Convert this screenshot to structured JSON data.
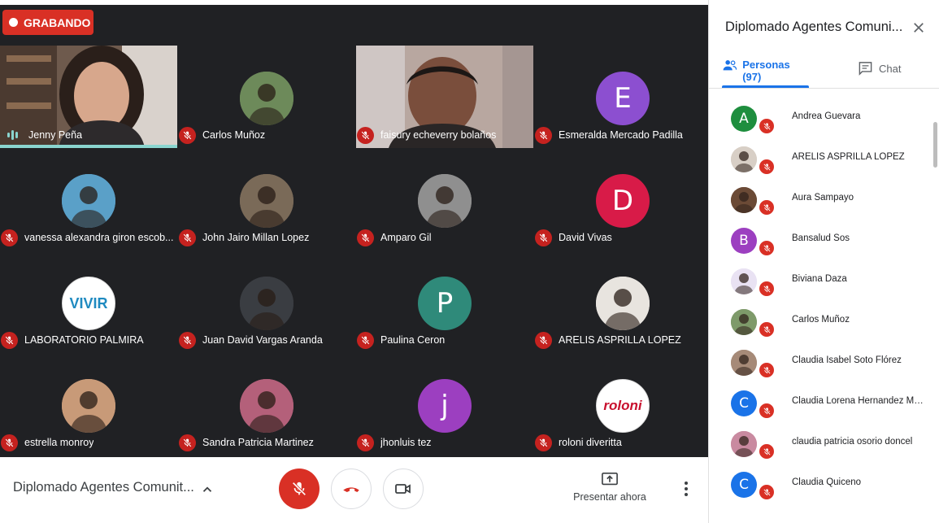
{
  "recording": {
    "label": "GRABANDO"
  },
  "participants_grid": [
    {
      "name": "Jenny Peña",
      "kind": "video",
      "speaking": true
    },
    {
      "name": "Carlos Muñoz",
      "kind": "photo",
      "color": "#6d8a5a"
    },
    {
      "name": "faisury echeverry bolaños",
      "kind": "video"
    },
    {
      "name": "Esmeralda Mercado Padilla",
      "kind": "letter",
      "letter": "E",
      "color": "#8c4fd0"
    },
    {
      "name": "vanessa alexandra giron escob...",
      "kind": "photo",
      "color": "#5aa0c8"
    },
    {
      "name": "John Jairo Millan Lopez",
      "kind": "photo",
      "color": "#7a6a58"
    },
    {
      "name": "Amparo Gil",
      "kind": "photo",
      "color": "#8f8f8f"
    },
    {
      "name": "David Vivas",
      "kind": "letter",
      "letter": "D",
      "color": "#d81b48"
    },
    {
      "name": "LABORATORIO PALMIRA",
      "kind": "logo",
      "logo_text": "VIVIR",
      "color": "#ffffff"
    },
    {
      "name": "Juan David Vargas Aranda",
      "kind": "photo",
      "color": "#3a3d42"
    },
    {
      "name": "Paulina Ceron",
      "kind": "letter",
      "letter": "P",
      "color": "#2f8a7a"
    },
    {
      "name": "ARELIS ASPRILLA LOPEZ",
      "kind": "photo",
      "color": "#e8e4df"
    },
    {
      "name": "estrella monroy",
      "kind": "photo",
      "color": "#c89a78"
    },
    {
      "name": "Sandra Patricia Martinez",
      "kind": "photo",
      "color": "#b4607a"
    },
    {
      "name": "jhonluis tez",
      "kind": "letter",
      "letter": "j",
      "color": "#9c3fc0"
    },
    {
      "name": "roloni diveritta",
      "kind": "logo",
      "logo_text": "roloni",
      "color": "#ffffff"
    }
  ],
  "bottom_bar": {
    "meeting_title": "Diplomado Agentes Comunit...",
    "present_label": "Presentar ahora"
  },
  "panel": {
    "title": "Diplomado Agentes Comuni...",
    "tab_people": "Personas (97)",
    "tab_chat": "Chat",
    "people": [
      {
        "name": "Andrea Guevara",
        "letter": "A",
        "color": "#1e8e3e"
      },
      {
        "name": "ARELIS ASPRILLA LOPEZ",
        "letter": "",
        "color": "#d8cfc6"
      },
      {
        "name": "Aura Sampayo",
        "letter": "",
        "color": "#6b4a36"
      },
      {
        "name": "Bansalud Sos",
        "letter": "B",
        "color": "#9c3fc0"
      },
      {
        "name": "Biviana Daza",
        "letter": "",
        "color": "#e9e2f3"
      },
      {
        "name": "Carlos Muñoz",
        "letter": "",
        "color": "#7e9a6a"
      },
      {
        "name": "Claudia Isabel Soto Flórez",
        "letter": "",
        "color": "#a68a78"
      },
      {
        "name": "Claudia Lorena Hernandez Mor...",
        "letter": "C",
        "color": "#1a73e8"
      },
      {
        "name": "claudia patricia osorio doncel",
        "letter": "",
        "color": "#c98aa0"
      },
      {
        "name": "Claudia Quiceno",
        "letter": "C",
        "color": "#1a73e8"
      }
    ]
  }
}
